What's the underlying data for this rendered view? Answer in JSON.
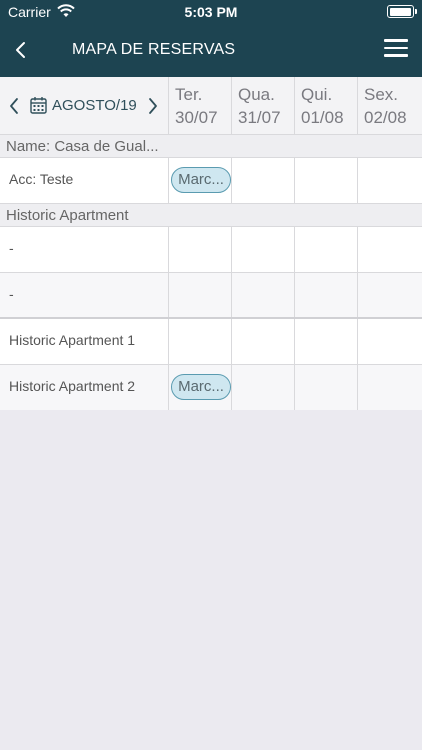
{
  "status_bar": {
    "carrier": "Carrier",
    "time": "5:03 PM",
    "battery_level": 1.0
  },
  "nav": {
    "title": "MAPA DE RESERVAS"
  },
  "calendar": {
    "month": "AGOSTO/19",
    "days": [
      {
        "weekday": "Ter.",
        "date": "30/07"
      },
      {
        "weekday": "Qua.",
        "date": "31/07"
      },
      {
        "weekday": "Qui.",
        "date": "01/08"
      },
      {
        "weekday": "Sex.",
        "date": "02/08"
      }
    ]
  },
  "rows": {
    "property_name": "Name: Casa de Gual...",
    "acc_teste": {
      "label": "Acc: Teste",
      "booking": "Marc..."
    },
    "section_historic": "Historic Apartment",
    "dash_1": "-",
    "dash_2": "-",
    "apt_1": "Historic Apartment 1",
    "apt_2": {
      "label": "Historic Apartment 2",
      "booking": "Marc..."
    }
  },
  "colors": {
    "nav_bg": "#1d4451",
    "booking_fill": "#cfe7f0",
    "booking_border": "#5a9bb0"
  }
}
